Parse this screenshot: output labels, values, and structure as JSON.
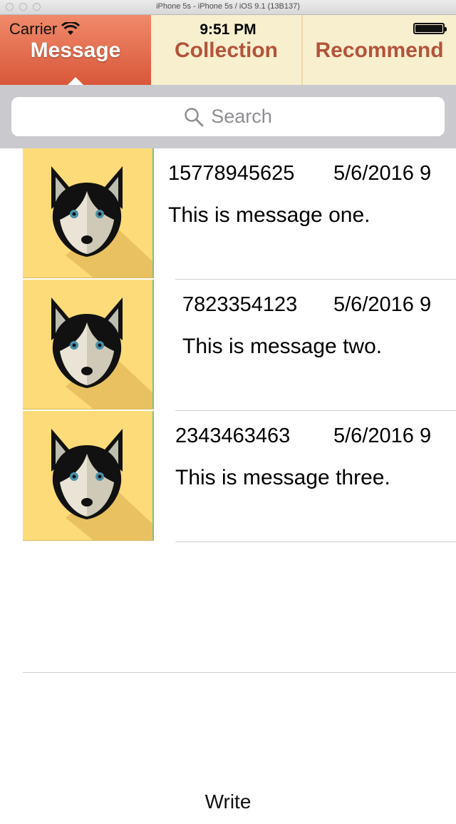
{
  "window": {
    "title": "iPhone 5s - iPhone 5s / iOS 9.1 (13B137)"
  },
  "status_bar": {
    "carrier": "Carrier",
    "time": "9:51 PM",
    "battery_level": 1.0
  },
  "tabs": [
    {
      "label": "Message",
      "selected": true
    },
    {
      "label": "Collection",
      "selected": false
    },
    {
      "label": "Recommend",
      "selected": false
    }
  ],
  "search": {
    "placeholder": "Search"
  },
  "messages": [
    {
      "phone": "15778945625",
      "date": "5/6/2016 9",
      "text": "This is message one."
    },
    {
      "phone": "7823354123",
      "date": "5/6/2016 9",
      "text": "This is message two."
    },
    {
      "phone": "2343463463",
      "date": "5/6/2016 9",
      "text": "This is message three."
    }
  ],
  "write_button": {
    "label": "Write"
  },
  "colors": {
    "message_tab": "#e06a4b",
    "tab_bg": "#f8efcf",
    "tab_text": "#b4533a",
    "avatar_bg": "#fddb78"
  }
}
